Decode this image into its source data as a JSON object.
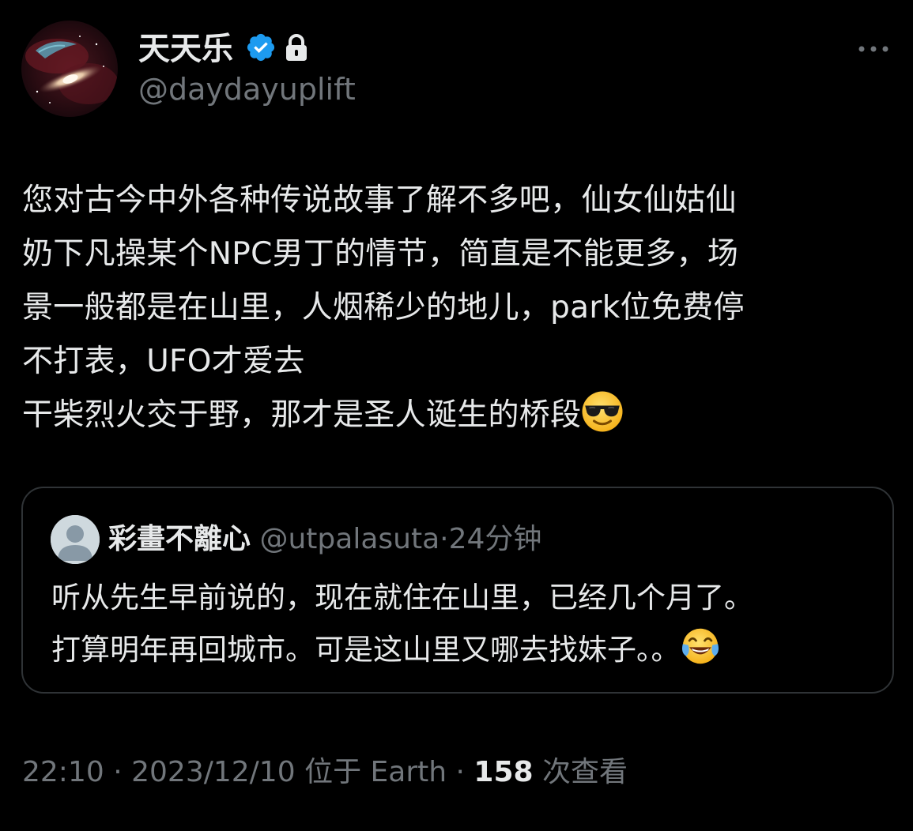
{
  "tweet": {
    "author": {
      "display_name": "天天乐",
      "handle": "@daydayuplift",
      "verified_icon": "verified-badge-icon",
      "protected_icon": "lock-icon",
      "avatar_icon": "galaxy-avatar"
    },
    "more_icon": "more-dots-icon",
    "text_lines": [
      "您对古今中外各种传说故事了解不多吧，仙女仙姑仙",
      "奶下凡操某个NPC男丁的情节，简直是不能更多，场",
      "景一般都是在山里，人烟稀少的地儿，park位免费停",
      "不打表，UFO才爱去",
      "干柴烈火交于野，那才是圣人诞生的桥段"
    ],
    "text_end_emoji": "smiling-face-with-sunglasses-emoji",
    "quote": {
      "author_name": "彩畫不離心",
      "handle": "@utpalasuta",
      "separator": "·",
      "time": "24分钟",
      "avatar_icon": "default-avatar-icon",
      "text_lines": [
        "听从先生早前说的，现在就住在山里，已经几个月了。",
        "打算明年再回城市。可是这山里又哪去找妹子。。"
      ],
      "text_end_emoji": "face-with-tears-of-joy-emoji"
    },
    "meta": {
      "time": "22:10",
      "sep1": "·",
      "date": "2023/12/10",
      "location": "位于 Earth",
      "sep2": "·",
      "views_count": "158",
      "views_label": "次查看"
    }
  },
  "colors": {
    "background": "#000000",
    "text_primary": "#e7e9ea",
    "text_secondary": "#71767b",
    "border": "#2f3336",
    "verified_blue": "#1d9bf0"
  }
}
